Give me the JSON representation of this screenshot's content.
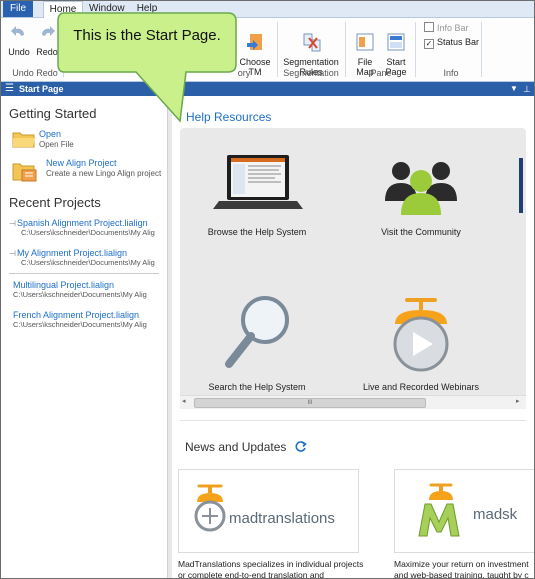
{
  "ribbon": {
    "tabs": [
      "File",
      "Home",
      "Window",
      "Help"
    ],
    "buttons": {
      "undo": "Undo",
      "redo": "Redo",
      "choose_tm": "Choose\nTM",
      "segmentation_rules": "Segmentation\nRules",
      "file_map": "File\nMap",
      "start_page": "Start\nPage"
    },
    "groups": {
      "undo_redo": "Undo Redo",
      "history": "ory",
      "segmentation": "Segmentation",
      "pane": "Pane",
      "info": "Info"
    },
    "checks": {
      "info_bar": {
        "label": "Info Bar",
        "checked": false
      },
      "status_bar": {
        "label": "Status Bar",
        "checked": true
      }
    }
  },
  "pane": {
    "title": "Start Page"
  },
  "callout": {
    "text": "This is the Start Page."
  },
  "left": {
    "getting_started": "Getting Started",
    "open": {
      "label": "Open",
      "sub": "Open File"
    },
    "new_project": {
      "label": "New Align Project",
      "sub": "Create a new Lingo Align project"
    },
    "recent_heading": "Recent Projects",
    "recent": [
      {
        "name": "Spanish Alignment Project.lialign",
        "path": "C:\\Users\\kschneider\\Documents\\My Alig"
      },
      {
        "name": "My Alignment Project.lialign",
        "path": "C:\\Users\\kschneider\\Documents\\My Alig"
      },
      {
        "name": "Multilingual Project.lialign",
        "path": "C:\\Users\\kschneider\\Documents\\My Alig"
      },
      {
        "name": "French Alignment Project.lialign",
        "path": "C:\\Users\\kschneider\\Documents\\My Alig"
      }
    ]
  },
  "help": {
    "title": "Help Resources",
    "items": [
      "Browse the Help System",
      "Visit the Community",
      "Search the Help System",
      "Live and Recorded Webinars"
    ],
    "scroll_mark": "III"
  },
  "news": {
    "title": "News and Updates",
    "logo1": "madtranslations",
    "logo2": "madsk",
    "desc1": [
      "MadTranslations specializes in individual projects",
      "or complete end-to-end translation and"
    ],
    "desc2": [
      "Maximize your return on investment",
      "and web-based training, taught by c"
    ]
  },
  "colors": {
    "accent": "#1e6fc8",
    "pane_header": "#2b5fa8",
    "callout_fill": "#c9f08a",
    "callout_border": "#6aa84f"
  }
}
